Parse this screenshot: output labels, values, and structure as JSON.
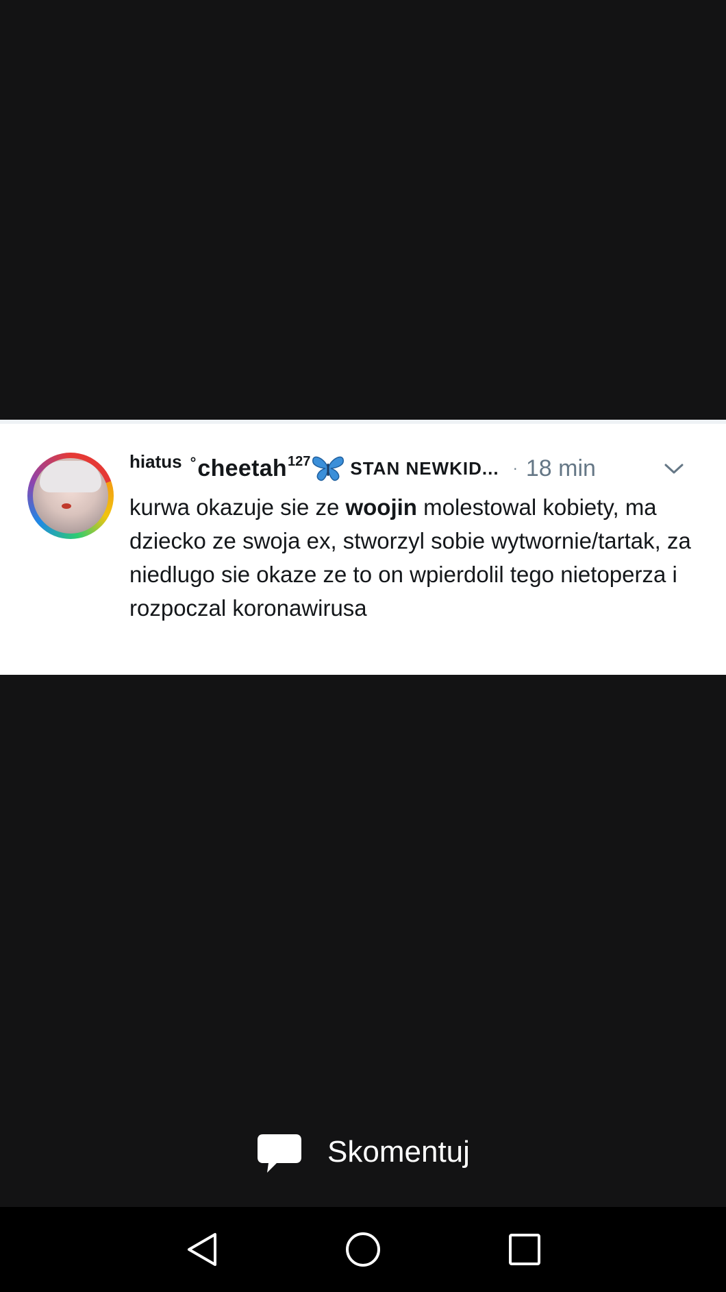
{
  "tweet": {
    "name_prefix": "hiatus",
    "name_degree": "°",
    "name_main": "cheetah",
    "name_sup": "127",
    "name_suffix": "STAN NEWKID...",
    "separator": "·",
    "time": "18 min",
    "text_before": "kurwa okazuje sie ze ",
    "text_bold": "woojin",
    "text_after": " molestowal kobiety, ma dziecko ze swoja ex, stworzyl sobie wytwornie/tartak, za niedlugo sie okaze ze to on wpierdolil tego nietoperza i rozpoczal koronawirusa"
  },
  "comment": {
    "label": "Skomentuj",
    "icon": "speech-bubble-icon"
  },
  "navbar": {
    "back_icon": "back-triangle-icon",
    "home_icon": "home-circle-icon",
    "recents_icon": "recents-square-icon"
  },
  "colors": {
    "background": "#131314",
    "navbar": "#000000",
    "tweet_text": "#14171a",
    "meta_text": "#657786",
    "butterfly": "#3b8fd9"
  }
}
